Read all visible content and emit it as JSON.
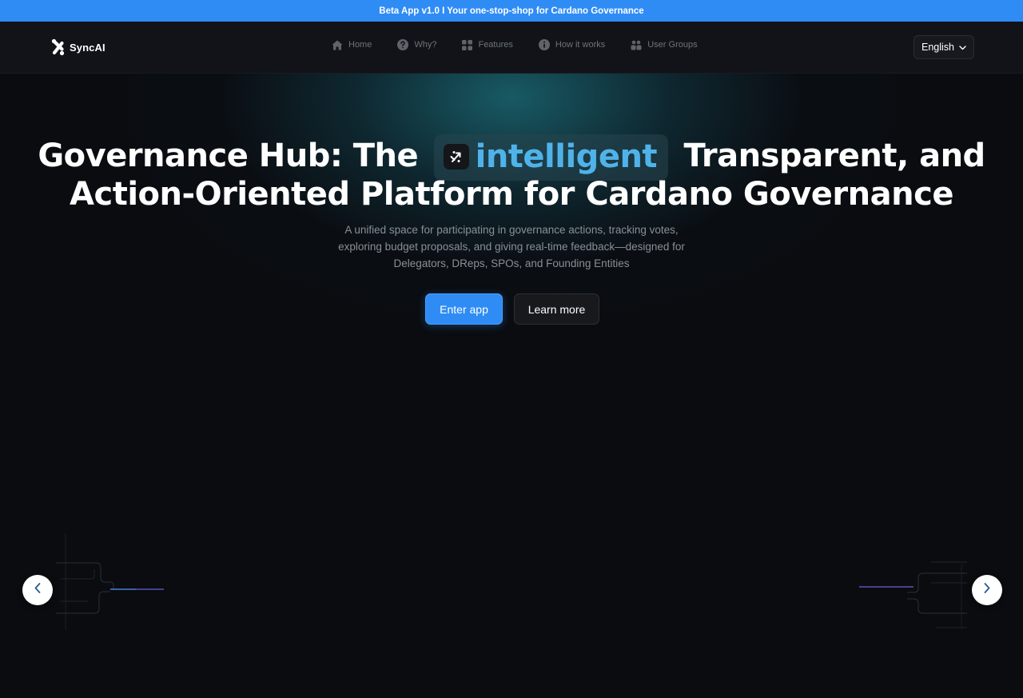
{
  "banner": {
    "text": "Beta App v1.0 I Your one-stop-shop for Cardano Governance"
  },
  "brand": {
    "name": "SyncAI",
    "icon": "syncai-logo"
  },
  "nav": {
    "items": [
      {
        "label": "Home",
        "icon": "home-icon"
      },
      {
        "label": "Why?",
        "icon": "question-icon"
      },
      {
        "label": "Features",
        "icon": "grid-icon"
      },
      {
        "label": "How it works",
        "icon": "info-icon"
      },
      {
        "label": "User Groups",
        "icon": "users-icon"
      }
    ],
    "language": {
      "selected": "English",
      "icon": "chevron-down-icon"
    }
  },
  "hero": {
    "headline_part1": "Governance Hub: The",
    "headline_highlight": "intelligent",
    "headline_part2": "Transparent, and",
    "headline_line2": "Action-Oriented Platform for Cardano Governance",
    "subtitle": "A unified space for participating in governance actions, tracking votes, exploring budget proposals, and giving real-time feedback—designed for Delegators, DReps, SPOs, and Founding Entities",
    "primary_cta": "Enter app",
    "secondary_cta": "Learn more"
  },
  "carousel": {
    "prev_icon": "chevron-left-icon",
    "next_icon": "chevron-right-icon"
  },
  "colors": {
    "accent": "#2f8cf5",
    "highlight_text": "#4fb3ea",
    "background": "#0a0c10",
    "nav_text": "#6e737c"
  }
}
